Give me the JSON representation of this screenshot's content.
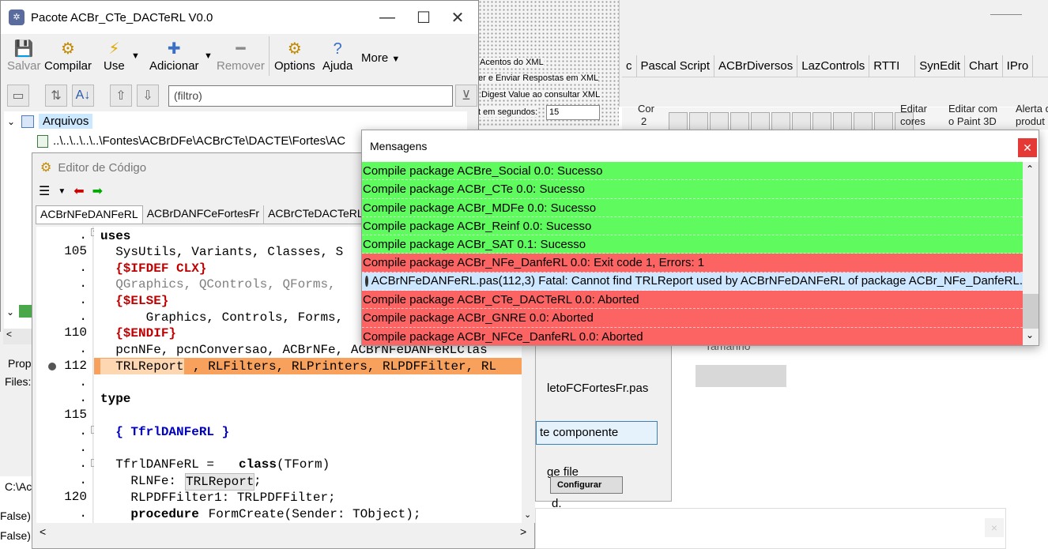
{
  "pkg_window": {
    "title": "Pacote ACBr_CTe_DACTeRL V0.0",
    "toolbar": {
      "salvar": "Salvar",
      "compilar": "Compilar",
      "use": "Use",
      "adicionar": "Adicionar",
      "remover": "Remover",
      "options": "Options",
      "ajuda": "Ajuda",
      "more": "More"
    },
    "filter_value": "(filtro)",
    "tree": {
      "root": "Arquivos",
      "file_path": "..\\..\\..\\..\\..\\Fontes\\ACBrDFe\\ACBrCTe\\DACTE\\Fortes\\AC"
    },
    "left_fragments": [
      "Prop",
      "Files:",
      "C:\\Ac",
      "False)",
      "False)"
    ]
  },
  "editor": {
    "title": "Editor de Código",
    "tabs": [
      "ACBrNFeDANFeRL",
      "ACBrDANFCeFortesFr",
      "ACBrCTeDACTeRL"
    ],
    "line_numbers": [
      ".",
      "105",
      ".",
      ".",
      ".",
      ".",
      "110",
      ".",
      "112",
      ".",
      ".",
      "115",
      ".",
      ".",
      ".",
      ".",
      "120",
      "."
    ],
    "code": {
      "l1": "uses",
      "l2": "  SysUtils, Variants, Classes, S",
      "l3": "  {$IFDEF CLX}",
      "l4": "  QGraphics, QControls, QForms, ",
      "l5": "  {$ELSE}",
      "l6": "      Graphics, Controls, Forms, ",
      "l7": "  {$ENDIF}",
      "l8": "  pcnNFe, pcnConversao, ACBrNFe, ACBrNFeDANFeRLClas",
      "l9a": "  TRLReport",
      "l9b": ", RLFilters, RLPrinters, RLPDFFilter, RL",
      "l11": "type",
      "l13": "  { TfrlDANFeRL }",
      "l15a": "  TfrlDANFeRL = ",
      "l15b": "class",
      "l15c": "(TForm)",
      "l16a": "    RLNFe: ",
      "l16b": "TRLReport",
      "l16c": ";",
      "l17": "    RLPDFFilter1: TRLPDFFilter;",
      "l18a": "    procedure",
      "l18b": " FormCreate(Sender: TObject);"
    }
  },
  "messages": {
    "title": "Mensagens",
    "items": [
      {
        "text": "Compile package ACBre_Social 0.0: Sucesso",
        "kind": "ok"
      },
      {
        "text": "Compile package ACBr_CTe 0.0: Sucesso",
        "kind": "ok"
      },
      {
        "text": "Compile package ACBr_MDFe 0.0: Sucesso",
        "kind": "ok"
      },
      {
        "text": "Compile package ACBr_Reinf 0.0: Sucesso",
        "kind": "ok"
      },
      {
        "text": "Compile package ACBr_SAT 0.1: Sucesso",
        "kind": "ok"
      },
      {
        "text": "Compile package ACBr_NFe_DanfeRL 0.0: Exit code 1, Errors: 1",
        "kind": "err"
      },
      {
        "text": "ACBrNFeDANFeRL.pas(112,3) Fatal: Cannot find TRLReport used by ACBrNFeDANFeRL of package ACBr_NFe_DanfeRL.",
        "kind": "info"
      },
      {
        "text": "Compile package ACBr_CTe_DACTeRL 0.0: Aborted",
        "kind": "err"
      },
      {
        "text": "Compile package ACBr_GNRE 0.0: Aborted",
        "kind": "err"
      },
      {
        "text": "Compile package ACBr_NFCe_DanfeRL 0.0: Aborted",
        "kind": "err"
      }
    ]
  },
  "background": {
    "options": [
      "Acentos do XML",
      "er e Enviar Respostas em XML",
      "Digest Value ao consultar XML",
      "t em segundos:"
    ],
    "timeout_value": "15",
    "palette_tabs": [
      "c",
      "Pascal Script",
      "ACBrDiversos",
      "LazControls",
      "RTTI",
      "SynEdit",
      "Chart",
      "IPro"
    ],
    "grid_fragments": [
      "Cor",
      "2",
      "Editar",
      "cores",
      "Editar com",
      "o Paint 3D",
      "Alerta d",
      "produt",
      "Tamanho"
    ],
    "file_fragment": "letoFCFortesFr.pas",
    "button_fragment": "te componente",
    "configurar": "Configurar",
    "file_fragment2": "ge file",
    "dot_fragment": "d."
  }
}
